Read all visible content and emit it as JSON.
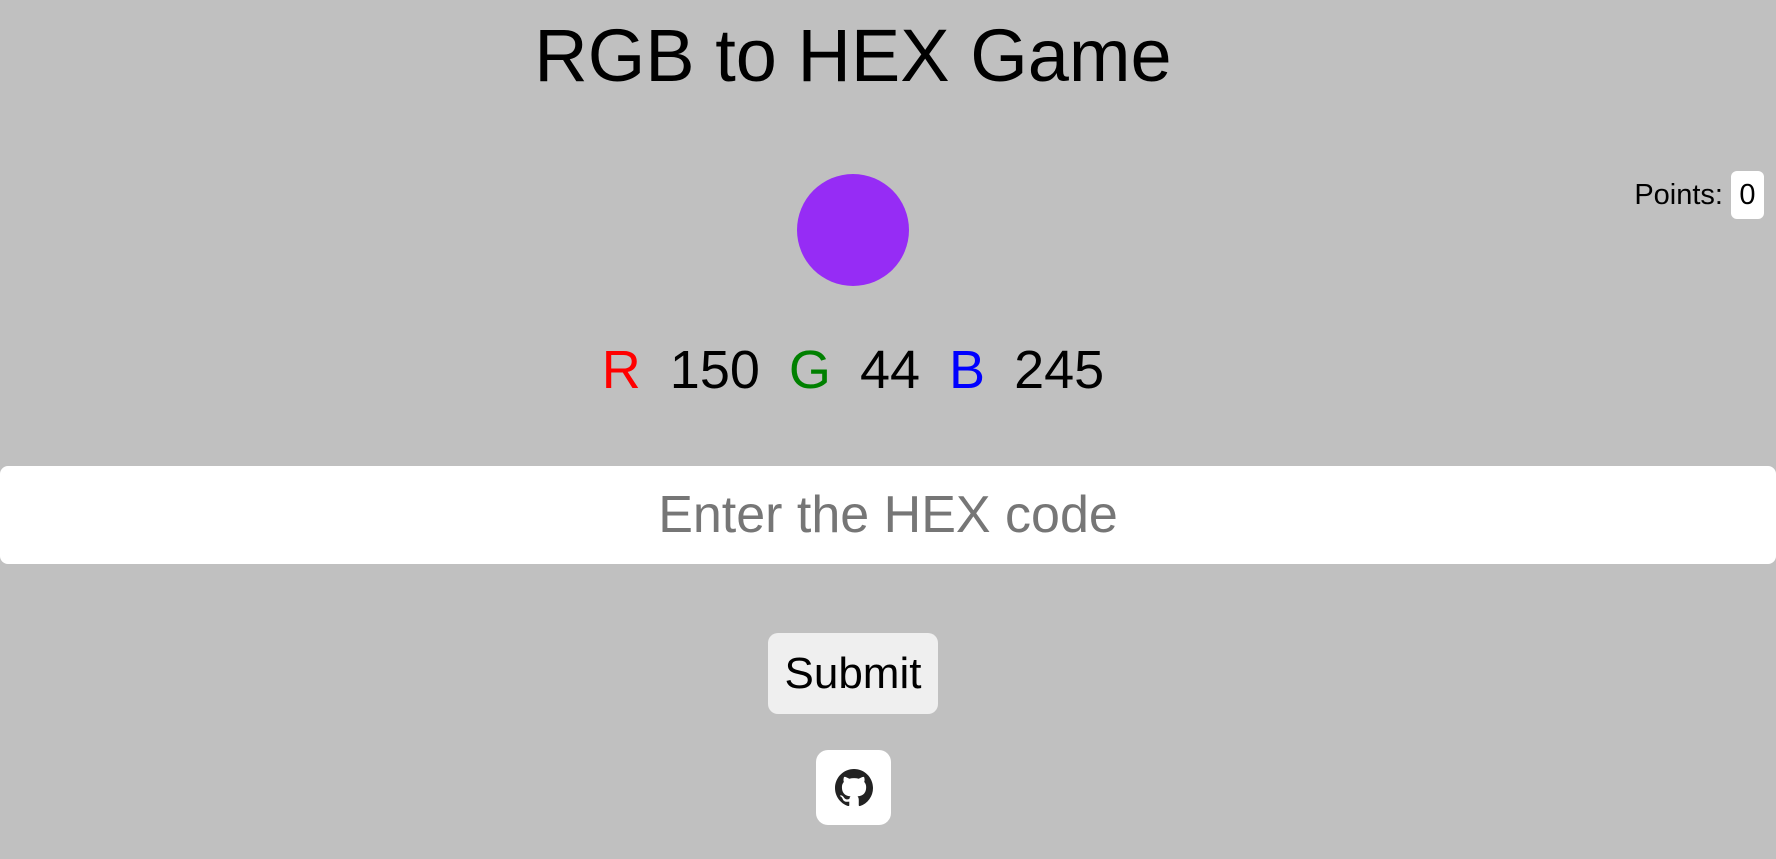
{
  "title": "RGB to HEX Game",
  "points": {
    "label": "Points:",
    "value": "0"
  },
  "swatch": {
    "color": "#962cf5"
  },
  "rgb": {
    "r_label": "R",
    "r_value": "150",
    "g_label": "G",
    "g_value": "44",
    "b_label": "B",
    "b_value": "245",
    "r_color": "#ff0000",
    "g_color": "#008000",
    "b_color": "#0000ff"
  },
  "hex_input": {
    "value": "",
    "placeholder": "Enter the HEX code"
  },
  "submit": {
    "label": "Submit"
  },
  "github": {
    "icon": "github-icon"
  }
}
